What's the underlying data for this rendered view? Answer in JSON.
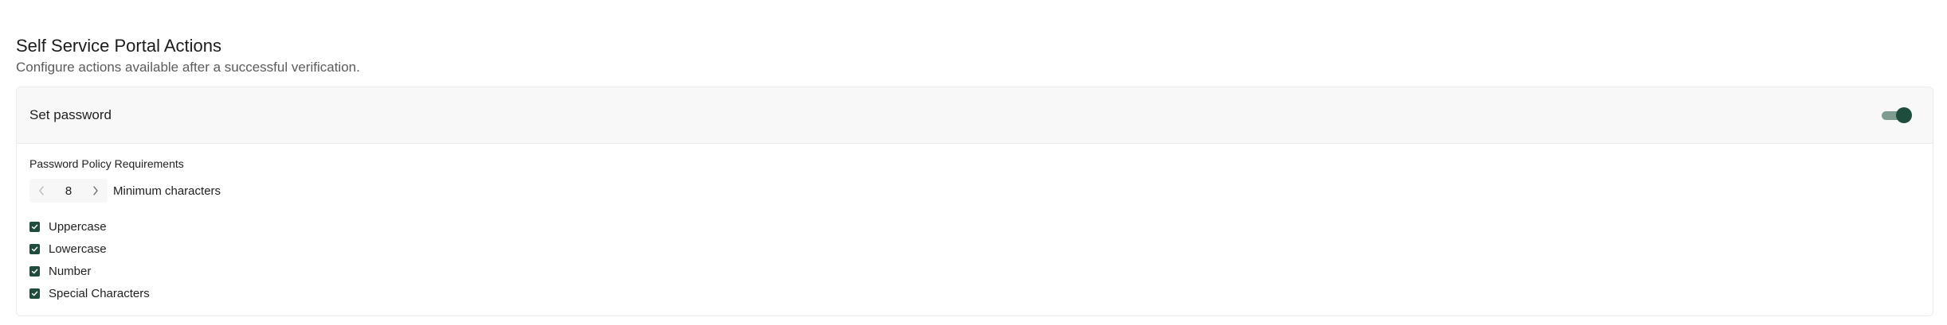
{
  "section": {
    "title": "Self Service Portal Actions",
    "subtitle": "Configure actions available after a successful verification."
  },
  "card": {
    "title": "Set password",
    "toggle_on": true,
    "policy_heading": "Password Policy Requirements",
    "min_chars": {
      "value": "8",
      "label": "Minimum characters"
    },
    "requirements": [
      {
        "label": "Uppercase",
        "checked": true
      },
      {
        "label": "Lowercase",
        "checked": true
      },
      {
        "label": "Number",
        "checked": true
      },
      {
        "label": "Special Characters",
        "checked": true
      }
    ]
  },
  "colors": {
    "accent": "#1f4d3d",
    "toggle_track": "#7f9c90",
    "header_bg": "#f8f8f8",
    "border": "#ececec"
  },
  "icons": {
    "decrement": "chevron-left-icon",
    "increment": "chevron-right-icon",
    "check": "check-icon"
  }
}
